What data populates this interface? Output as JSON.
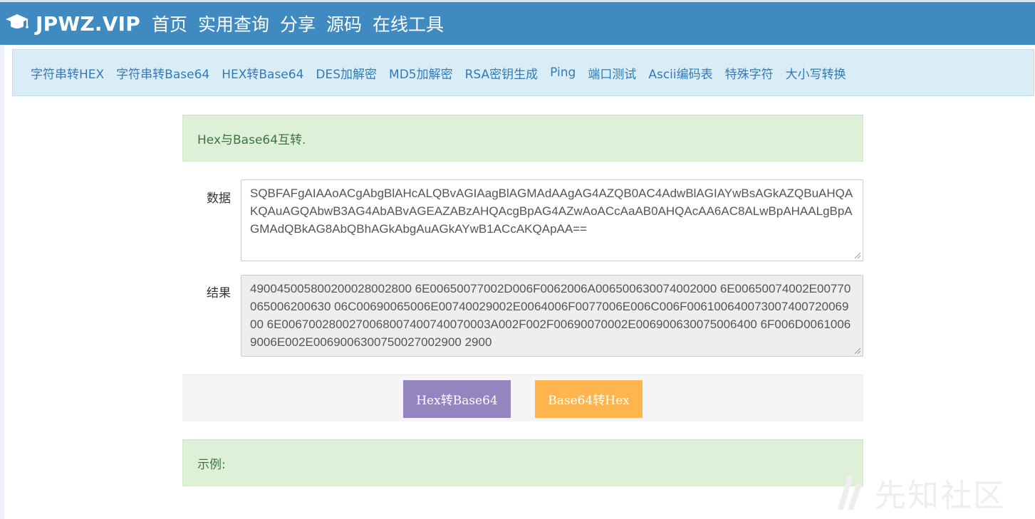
{
  "header": {
    "brand_icon": "graduation-cap-icon",
    "brand": "JPWZ.VIP",
    "nav": [
      "首页",
      "实用查询",
      "分享",
      "源码",
      "在线工具"
    ]
  },
  "tools": [
    "字符串转HEX",
    "字符串转Base64",
    "HEX转Base64",
    "DES加解密",
    "MD5加解密",
    "RSA密钥生成",
    "Ping",
    "端口测试",
    "Ascii编码表",
    "特殊字符",
    "大小写转换"
  ],
  "main": {
    "intro": "Hex与Base64互转.",
    "data_label": "数据",
    "data_value": "SQBFAFgAIAAoACgAbgBlAHcALQBvAGIAagBlAGMAdAAgAG4AZQB0AC4AdwBlAGIAYwBsAGkAZQBuAHQAKQAuAGQAbwB3AG4AbABvAGEAZABzAHQAcgBpAG4AZwAoACcAaAB0AHQAcAA6AC8ALwBpAHAALgBpAGMAdQBkAG8AbQBhAGkAbgAuAGkAYwB1ACcAKQApAA==",
    "result_label": "结果",
    "result_value": "490045005800200028002800 6E00650077002D006F0062006A006500630074002000 6E00650074002E00770065006200630 06C00690065006E00740029002E0064006F0077006E006C006F00610064007300740072006900 6E0067002800270068007400740070003A002F002F00690070002E006900630075006400 6F006D00610069006E002E0069006300750027002900 2900",
    "btn_hex_to_b64": "Hex转Base64",
    "btn_b64_to_hex": "Base64转Hex",
    "example": "示例:"
  },
  "watermark": "先知社区",
  "colors": {
    "header_bg": "#3f8bc1",
    "toolbar_bg": "#d9edf7",
    "link": "#337ab7",
    "alert_bg": "#dff0d8",
    "alert_text": "#3c763d",
    "btn_purple": "#9585bf",
    "btn_orange": "#ffb54d"
  }
}
